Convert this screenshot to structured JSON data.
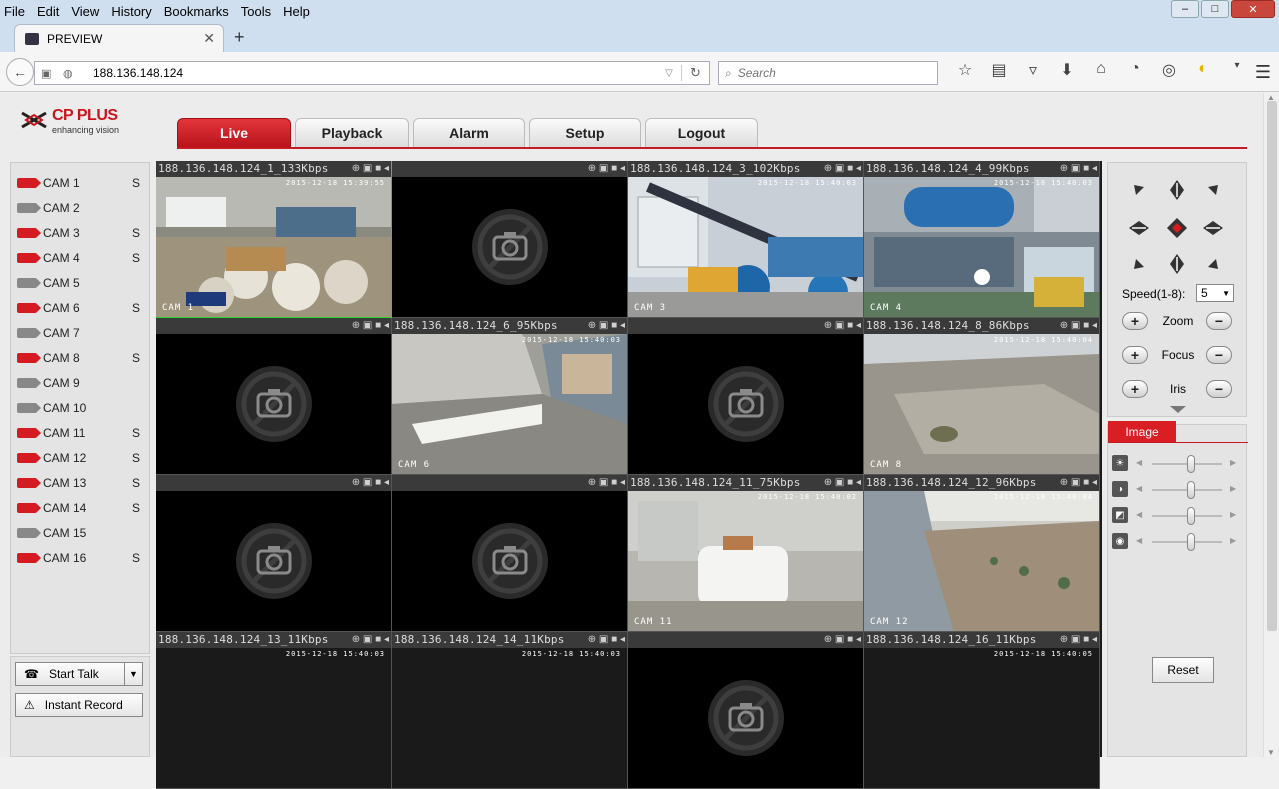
{
  "browser": {
    "menu": [
      "File",
      "Edit",
      "View",
      "History",
      "Bookmarks",
      "Tools",
      "Help"
    ],
    "tab_title": "PREVIEW",
    "url": "188.136.148.124",
    "search_placeholder": "Search"
  },
  "brand": {
    "name": "CP PLUS",
    "tagline": "enhancing vision"
  },
  "main_tabs": [
    "Live",
    "Playback",
    "Alarm",
    "Setup",
    "Logout"
  ],
  "cameras": [
    {
      "label": "CAM 1",
      "flag": "S",
      "active": true
    },
    {
      "label": "CAM 2",
      "flag": "",
      "active": false
    },
    {
      "label": "CAM 3",
      "flag": "S",
      "active": true
    },
    {
      "label": "CAM 4",
      "flag": "S",
      "active": true
    },
    {
      "label": "CAM 5",
      "flag": "",
      "active": false
    },
    {
      "label": "CAM 6",
      "flag": "S",
      "active": true
    },
    {
      "label": "CAM 7",
      "flag": "",
      "active": false
    },
    {
      "label": "CAM 8",
      "flag": "S",
      "active": true
    },
    {
      "label": "CAM 9",
      "flag": "",
      "active": false
    },
    {
      "label": "CAM 10",
      "flag": "",
      "active": false
    },
    {
      "label": "CAM 11",
      "flag": "S",
      "active": true
    },
    {
      "label": "CAM 12",
      "flag": "S",
      "active": true
    },
    {
      "label": "CAM 13",
      "flag": "S",
      "active": true
    },
    {
      "label": "CAM 14",
      "flag": "S",
      "active": true
    },
    {
      "label": "CAM 15",
      "flag": "",
      "active": false
    },
    {
      "label": "CAM 16",
      "flag": "S",
      "active": true
    }
  ],
  "talk": {
    "start_talk": "Start Talk",
    "instant_record": "Instant Record"
  },
  "tiles": [
    {
      "title": "188.136.148.124_1_133Kbps",
      "stamp": "2015-12-18  15:39:55",
      "cam": "CAM 1",
      "scene": "warehouse",
      "selected": true
    },
    {
      "title": "",
      "stamp": "",
      "cam": "",
      "scene": "none"
    },
    {
      "title": "188.136.148.124_3_102Kbps",
      "stamp": "2015-12-18  15:40:03",
      "cam": "CAM 3",
      "scene": "plant"
    },
    {
      "title": "188.136.148.124_4_99Kbps",
      "stamp": "2015-12-18  15:40:03",
      "cam": "CAM 4",
      "scene": "tanks"
    },
    {
      "title": "",
      "stamp": "",
      "cam": "",
      "scene": "none"
    },
    {
      "title": "188.136.148.124_6_95Kbps",
      "stamp": "2015-12-18  15:40:03",
      "cam": "CAM 6",
      "scene": "lab"
    },
    {
      "title": "",
      "stamp": "",
      "cam": "",
      "scene": "none"
    },
    {
      "title": "188.136.148.124_8_86Kbps",
      "stamp": "2015-12-18  15:40:04",
      "cam": "CAM 8",
      "scene": "yard"
    },
    {
      "title": "",
      "stamp": "",
      "cam": "",
      "scene": "none"
    },
    {
      "title": "",
      "stamp": "",
      "cam": "",
      "scene": "none"
    },
    {
      "title": "188.136.148.124_11_75Kbps",
      "stamp": "2015-12-18  15:40:02",
      "cam": "CAM 11",
      "scene": "tank-room"
    },
    {
      "title": "188.136.148.124_12_96Kbps",
      "stamp": "2015-12-18  15:40:04",
      "cam": "CAM 12",
      "scene": "field"
    },
    {
      "title": "188.136.148.124_13_11Kbps",
      "stamp": "2015-12-18  15:40:03",
      "cam": "",
      "scene": "dark"
    },
    {
      "title": "188.136.148.124_14_11Kbps",
      "stamp": "2015-12-18  15:40:03",
      "cam": "",
      "scene": "dark"
    },
    {
      "title": "",
      "stamp": "",
      "cam": "",
      "scene": "none"
    },
    {
      "title": "188.136.148.124_16_11Kbps",
      "stamp": "2015-12-18  15:40:05",
      "cam": "",
      "scene": "dark"
    }
  ],
  "ptz": {
    "speed_label": "Speed(1-8):",
    "speed_value": "5",
    "zoom": "Zoom",
    "focus": "Focus",
    "iris": "Iris"
  },
  "image": {
    "tab": "Image",
    "sliders": [
      {
        "icon": "brightness-icon",
        "level": 0.55
      },
      {
        "icon": "contrast-icon",
        "level": 0.55
      },
      {
        "icon": "saturation-icon",
        "level": 0.55
      },
      {
        "icon": "hue-icon",
        "level": 0.55
      }
    ],
    "reset": "Reset"
  },
  "colors": {
    "accent": "#d51b22",
    "selected_tile": "#2bd62b"
  }
}
